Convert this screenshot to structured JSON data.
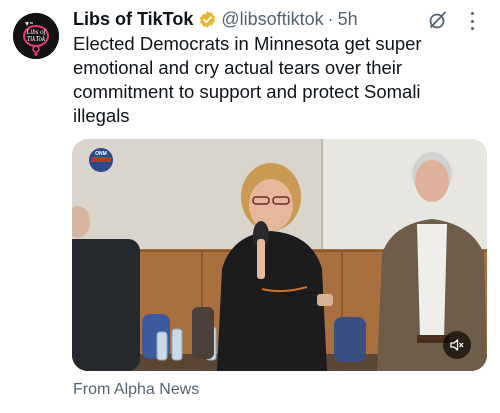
{
  "tweet": {
    "display_name": "Libs of TikTok",
    "handle": "@libsoftiktok",
    "separator": "·",
    "time": "5h",
    "text": "Elected Democrats in Minnesota get super emotional and cry actual tears over their commitment to support and protect Somali illegals",
    "avatar_text_line1": "Libs of",
    "avatar_text_line2": "TikTok",
    "media_logo_text": "ONM",
    "source": "From Alpha News"
  },
  "colors": {
    "text_primary": "#0f1419",
    "text_secondary": "#536471",
    "verified_gold": "#e8b62c"
  },
  "icons": {
    "verified": "verified-badge-icon",
    "grok": "grok-icon",
    "more": "more-icon",
    "mute": "muted-speaker-icon"
  }
}
